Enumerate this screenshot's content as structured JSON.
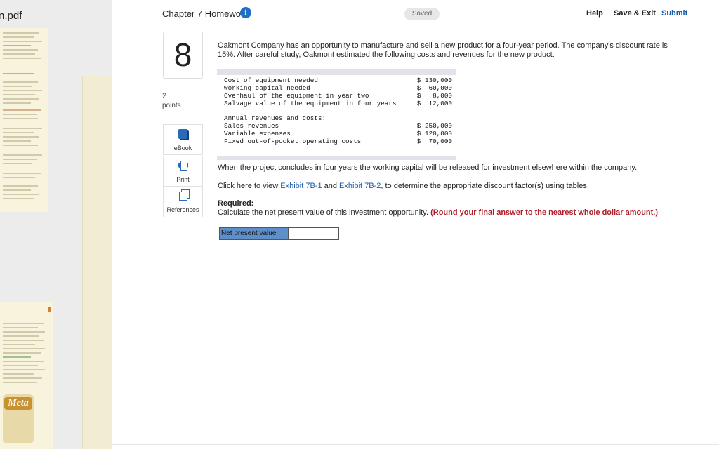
{
  "left_window": {
    "file_title": "n.pdf",
    "logo_text": "Meta"
  },
  "header": {
    "chapter_title": "Chapter 7 Homework",
    "info_icon": "info-icon",
    "saved_label": "Saved",
    "help_label": "Help",
    "save_exit_label": "Save & Exit",
    "submit_label": "Submit"
  },
  "question": {
    "number": "8",
    "points_value": "2",
    "points_label": "points"
  },
  "sidebar_tools": {
    "ebook_label": "eBook",
    "print_label": "Print",
    "references_label": "References"
  },
  "problem": {
    "intro": "Oakmont Company has an opportunity to manufacture and sell a new product for a four-year period. The company's discount rate is 15%. After careful study, Oakmont estimated the following costs and revenues for the new product:",
    "table": {
      "rows_a": [
        {
          "label": "Cost of equipment needed",
          "value": "$ 130,000"
        },
        {
          "label": "Working capital needed",
          "value": "$  60,000"
        },
        {
          "label": "Overhaul of the equipment in year two",
          "value": "$   8,000"
        },
        {
          "label": "Salvage value of the equipment in four years",
          "value": "$  12,000"
        }
      ],
      "annual_header": "Annual revenues and costs:",
      "rows_b": [
        {
          "label": "Sales revenues",
          "value": "$ 250,000"
        },
        {
          "label": "Variable expenses",
          "value": "$ 120,000"
        },
        {
          "label": "Fixed out-of-pocket operating costs",
          "value": "$  70,000"
        }
      ]
    },
    "release_text": "When the project concludes in four years the working capital will be released for investment elsewhere within the company.",
    "exhibit_prefix": "Click here to view ",
    "exhibit_link_1": "Exhibit 7B-1",
    "exhibit_and": " and ",
    "exhibit_link_2": "Exhibit 7B-2",
    "exhibit_suffix": ", to determine the appropriate discount factor(s) using tables.",
    "required_label": "Required:",
    "instruction": "Calculate the net present value of this investment opportunity. ",
    "round_note": "(Round your final answer to the nearest whole dollar amount.)"
  },
  "answer": {
    "npv_label": "Net present value",
    "npv_value": ""
  }
}
